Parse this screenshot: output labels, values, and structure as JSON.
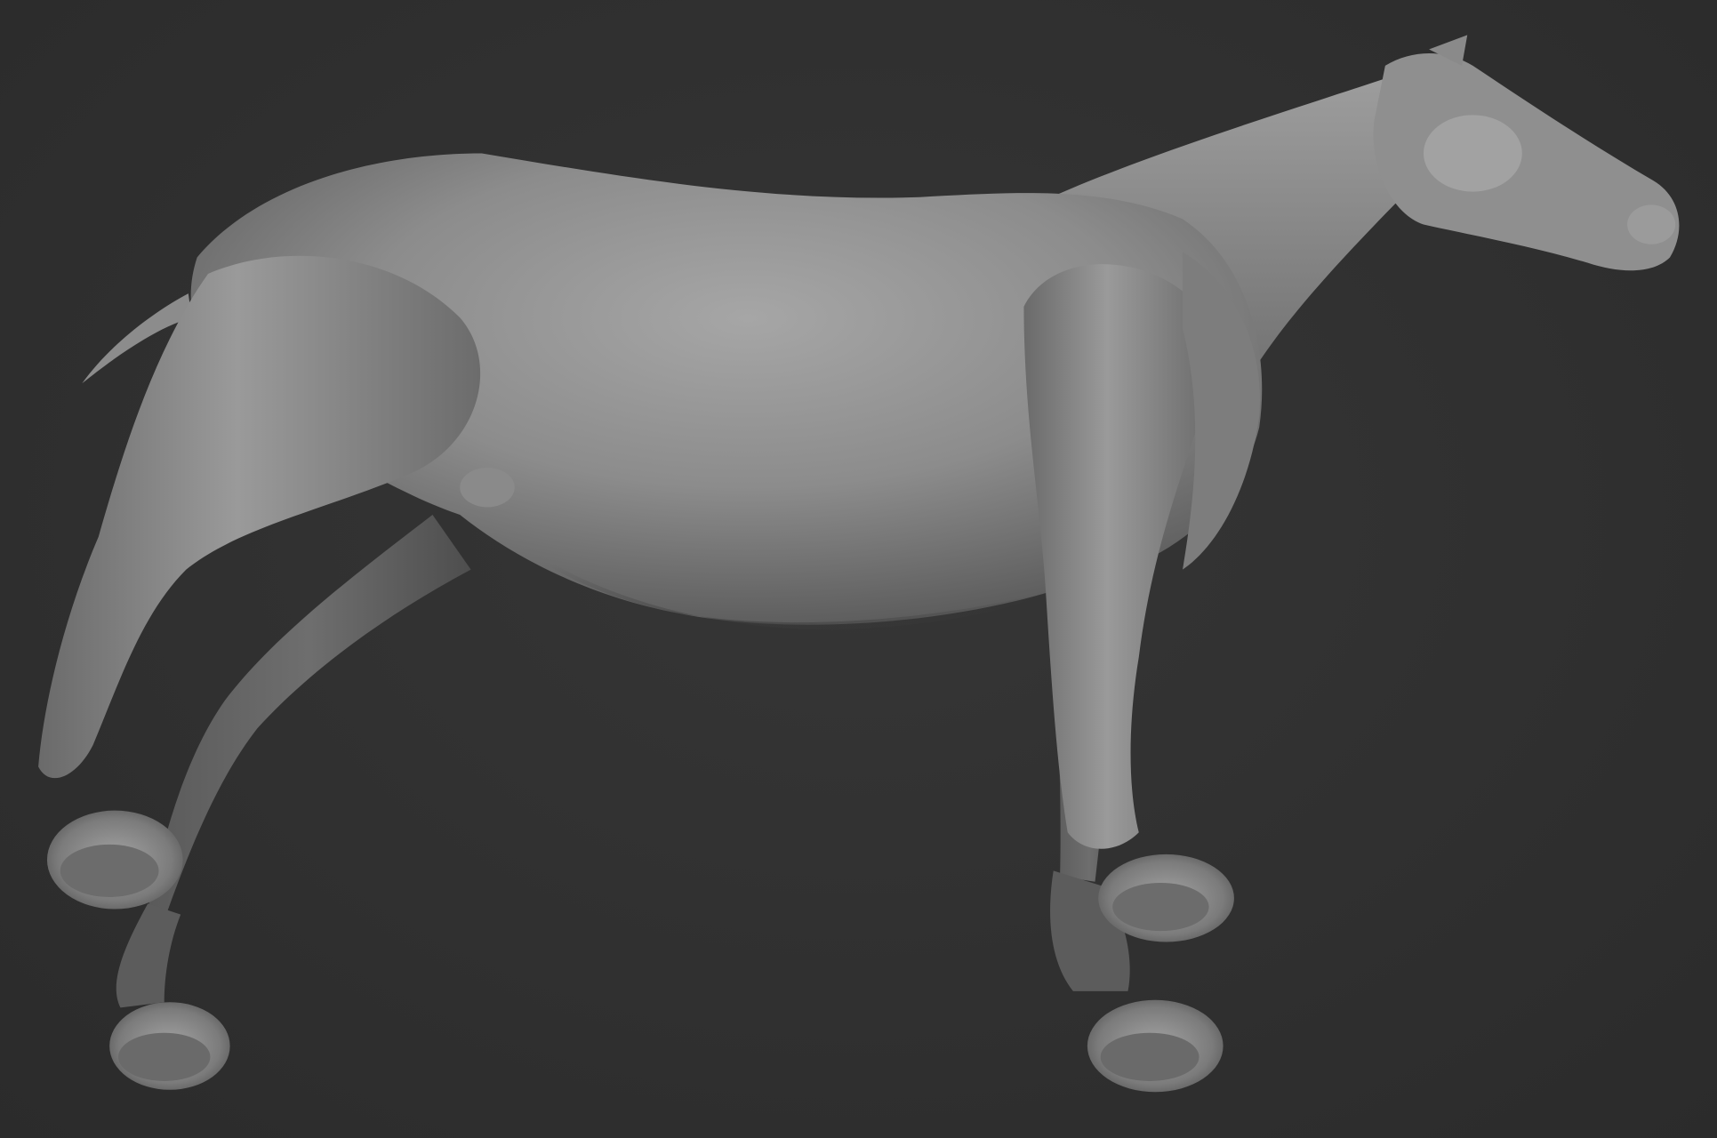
{
  "scene": {
    "background_color": "#2f2f2f",
    "material_color": "#8a8a8a",
    "subject": "horse-sculpt"
  }
}
